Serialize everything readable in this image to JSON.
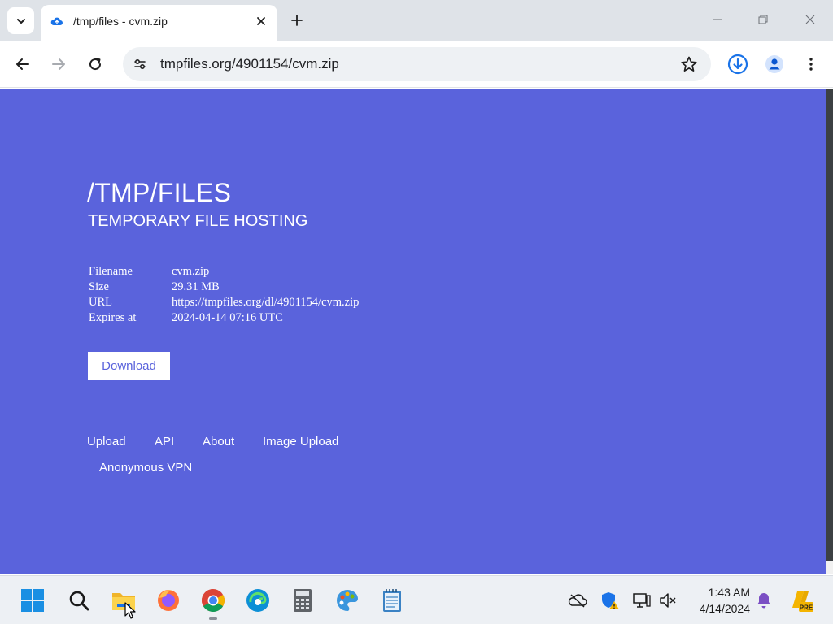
{
  "browser": {
    "tab": {
      "title": "/tmp/files - cvm.zip",
      "favicon": "cloud-upload-icon",
      "close_icon": "close-icon"
    },
    "tab_search_icon": "chevron-down-icon",
    "new_tab_icon": "plus-icon",
    "window_controls": [
      "minimize-icon",
      "restore-icon",
      "close-icon"
    ],
    "toolbar": {
      "back_icon": "arrow-left-icon",
      "forward_icon": "arrow-right-icon",
      "reload_icon": "reload-icon",
      "site_info_icon": "tune-icon",
      "url": "tmpfiles.org/4901154/cvm.zip",
      "bookmark_icon": "star-icon",
      "download_icon": "download-icon",
      "profile_icon": "profile-icon",
      "menu_icon": "more-vert-icon"
    }
  },
  "page": {
    "background_color": "#5a63dc",
    "title": "/TMP/FILES",
    "subtitle": "TEMPORARY FILE HOSTING",
    "file_info": [
      {
        "label": "Filename",
        "value": "cvm.zip"
      },
      {
        "label": "Size",
        "value": "29.31 MB"
      },
      {
        "label": "URL",
        "value": "https://tmpfiles.org/dl/4901154/cvm.zip"
      },
      {
        "label": "Expires at",
        "value": "2024-04-14 07:16 UTC"
      }
    ],
    "download_label": "Download",
    "footer_links": [
      "Upload",
      "API",
      "About",
      "Image Upload",
      "Anonymous VPN"
    ]
  },
  "taskbar": {
    "apps": [
      "windows-start-icon",
      "search-icon",
      "file-explorer-icon",
      "firefox-icon",
      "chrome-icon",
      "edge-icon",
      "calculator-icon",
      "paint-icon",
      "notepad-icon"
    ],
    "tray": [
      "onedrive-icon",
      "security-warning-icon",
      "network-icon",
      "volume-muted-icon"
    ],
    "time": "1:43 AM",
    "date": "4/14/2024",
    "notification_icon": "bell-icon",
    "copilot_icon": "copilot-pre-icon"
  }
}
